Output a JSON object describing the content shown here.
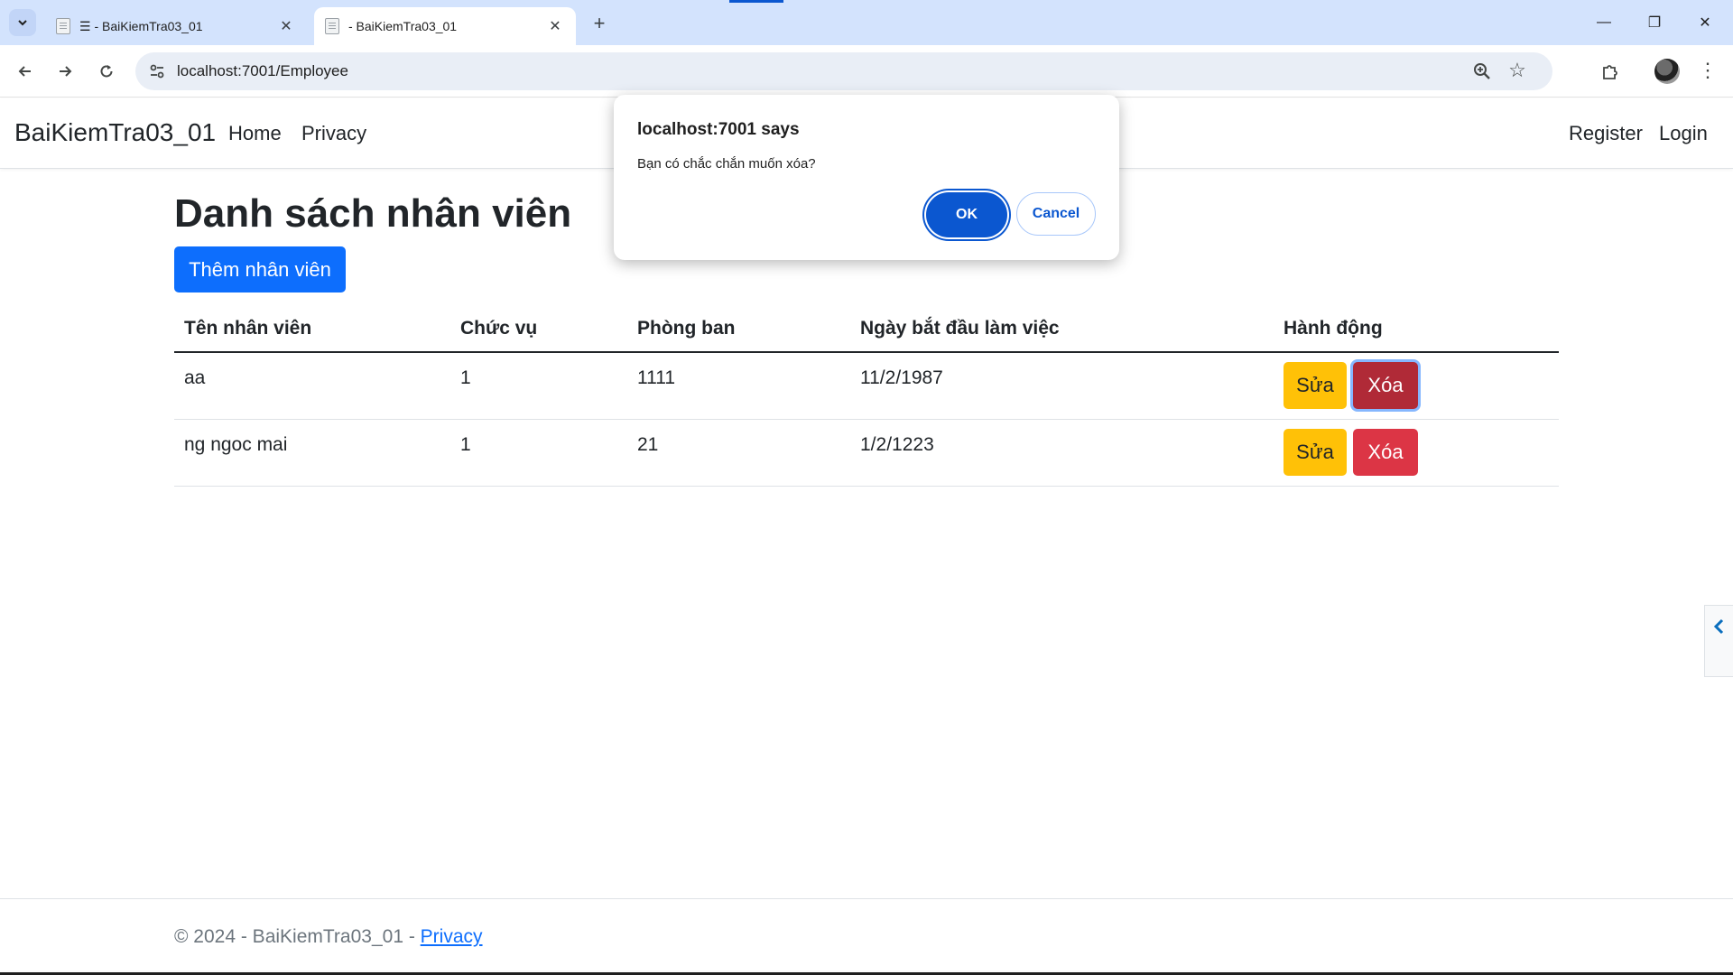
{
  "browser": {
    "tabs": [
      {
        "title": "☰ - BaiKiemTra03_01",
        "active": false
      },
      {
        "title": "- BaiKiemTra03_01",
        "active": true
      }
    ],
    "url": "localhost:7001/Employee",
    "window_controls": {
      "minimize": "—",
      "restore": "❐",
      "close": "✕"
    }
  },
  "navbar": {
    "brand": "BaiKiemTra03_01",
    "links": [
      "Home",
      "Privacy"
    ],
    "right_links": [
      "Register",
      "Login"
    ]
  },
  "main": {
    "title": "Danh sách nhân viên",
    "add_button": "Thêm nhân viên",
    "table": {
      "headers": [
        "Tên nhân viên",
        "Chức vụ",
        "Phòng ban",
        "Ngày bắt đầu làm việc",
        "Hành động"
      ],
      "rows": [
        {
          "name": "aa",
          "position": "1",
          "department": "1111",
          "start_date": "11/2/1987",
          "edit": "Sửa",
          "delete": "Xóa"
        },
        {
          "name": "ng ngoc mai",
          "position": "1",
          "department": "21",
          "start_date": "1/2/1223",
          "edit": "Sửa",
          "delete": "Xóa"
        }
      ]
    }
  },
  "footer": {
    "text": "© 2024 - BaiKiemTra03_01 - ",
    "link": "Privacy"
  },
  "dialog": {
    "title": "localhost:7001 says",
    "message": "Bạn có chắc chắn muốn xóa?",
    "ok_label": "OK",
    "cancel_label": "Cancel"
  },
  "colors": {
    "primary": "#0d6efd",
    "warning": "#ffc107",
    "danger": "#dc3545",
    "chrome_accent": "#0b57d0",
    "tabbar": "#d3e3fd"
  }
}
